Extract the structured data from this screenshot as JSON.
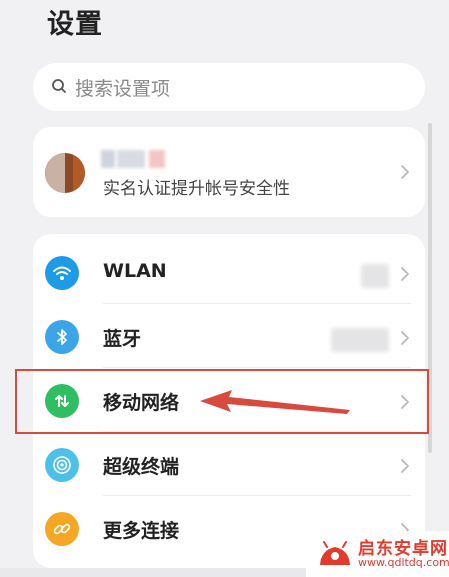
{
  "header": {
    "title": "设置"
  },
  "search": {
    "placeholder": "搜索设置项"
  },
  "account": {
    "subtitle": "实名认证提升帐号安全性"
  },
  "settings_items": [
    {
      "label": "WLAN",
      "icon": "wifi-icon",
      "icon_color": "#1e9be6"
    },
    {
      "label": "蓝牙",
      "icon": "bluetooth-icon",
      "icon_color": "#3ba5e8"
    },
    {
      "label": "移动网络",
      "icon": "mobile-network-icon",
      "icon_color": "#2fbf62"
    },
    {
      "label": "超级终端",
      "icon": "super-device-icon",
      "icon_color": "#4dc0ea"
    },
    {
      "label": "更多连接",
      "icon": "link-icon",
      "icon_color": "#f5a623"
    }
  ],
  "annotation": {
    "highlighted_item": "移动网络",
    "color": "#d94a3e"
  },
  "watermark": {
    "title": "启东安卓网",
    "url": "www.qdltdq.com",
    "color": "#e23a2d"
  }
}
